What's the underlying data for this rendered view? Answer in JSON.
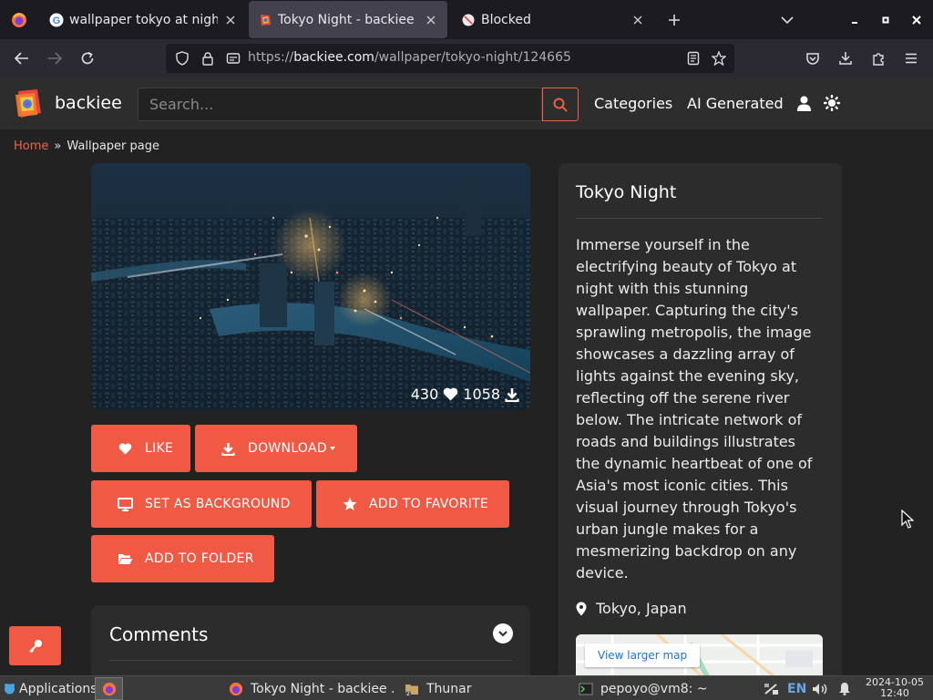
{
  "browser": {
    "tabs": [
      {
        "title": "wallpaper tokyo at night - G",
        "favicon": "google-icon",
        "active": false
      },
      {
        "title": "Tokyo Night - backiee",
        "favicon": "backiee-icon",
        "active": true
      },
      {
        "title": "Blocked",
        "favicon": "blocked-icon",
        "active": false
      }
    ],
    "url": {
      "scheme": "https://",
      "host": "backiee.com",
      "path": "/wallpaper/tokyo-night/124665"
    }
  },
  "site": {
    "brand": "backiee",
    "search_placeholder": "Search...",
    "nav": [
      "Categories",
      "AI Generated"
    ],
    "accent": "#f05a45"
  },
  "breadcrumb": {
    "home": "Home",
    "separator": "»",
    "current": "Wallpaper page"
  },
  "wallpaper": {
    "likes": "430",
    "downloads": "1058"
  },
  "actions": {
    "like": "LIKE",
    "download": "DOWNLOAD",
    "set_background": "SET AS BACKGROUND",
    "add_favorite": "ADD TO FAVORITE",
    "add_folder": "ADD TO FOLDER"
  },
  "comments": {
    "title": "Comments"
  },
  "info": {
    "title": "Tokyo Night",
    "description": "Immerse yourself in the electrifying beauty of Tokyo at night with this stunning wallpaper. Capturing the city's sprawling metropolis, the image showcases a dazzling array of lights against the evening sky, reflecting off the serene river below. The intricate network of roads and buildings illustrates the dynamic heartbeat of one of Asia's most iconic cities. This visual journey through Tokyo's urban jungle makes for a mesmerizing backdrop on any device.",
    "location": "Tokyo, Japan",
    "map_button": "View larger map"
  },
  "taskbar": {
    "applications": "Applications",
    "windows": [
      {
        "title": "Tokyo Night - backiee ..."
      },
      {
        "title": "Thunar"
      },
      {
        "title": "pepoyo@vm8: ~"
      }
    ],
    "lang": "EN",
    "date": "2024-10-05",
    "time": "12:40"
  }
}
